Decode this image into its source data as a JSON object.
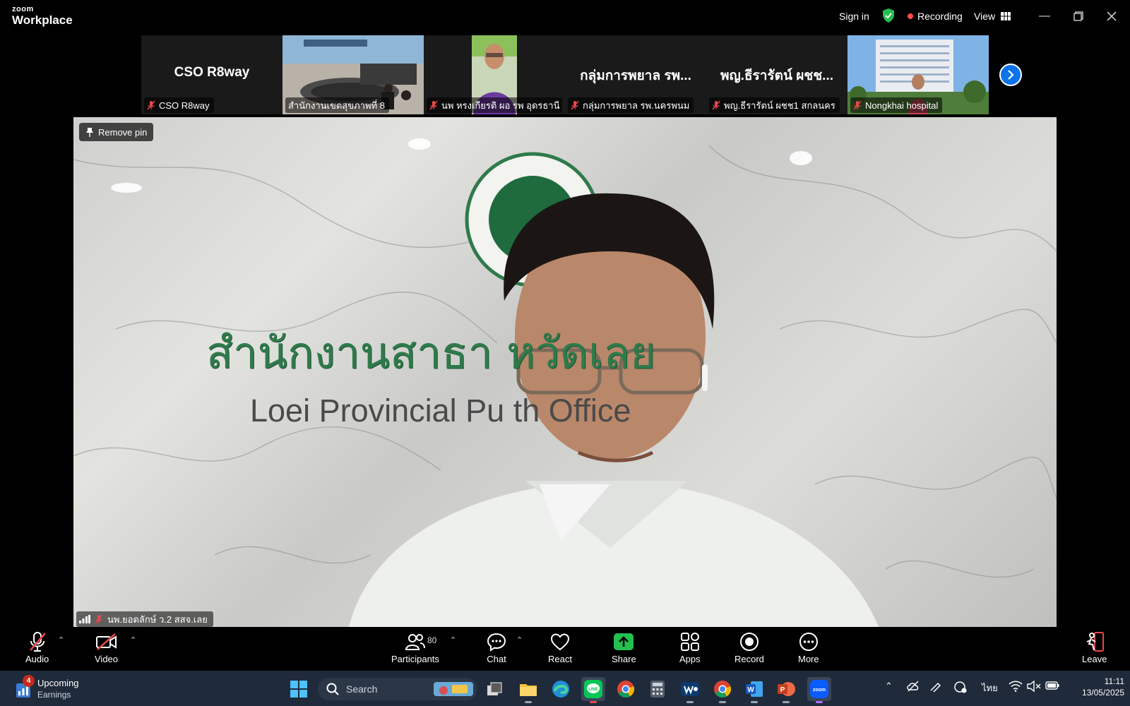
{
  "brand": {
    "line1": "zoom",
    "line2": "Workplace"
  },
  "titlebar": {
    "sign_in": "Sign in",
    "recording": "Recording",
    "view": "View"
  },
  "thumbnails": [
    {
      "title": "CSO R8way",
      "label": "CSO R8way",
      "type": "name"
    },
    {
      "title": "",
      "label": "สำนักงานเขตสุขภาพที่ 8",
      "type": "video-room"
    },
    {
      "title": "",
      "label": "นพ หรงเกียรติ ผอ รพ อุดรธานี",
      "type": "video-person"
    },
    {
      "title": "กลุ่มการพยาล รพ...",
      "label": "กลุ่มการพยาล รพ.นครพนม",
      "type": "name"
    },
    {
      "title": "พญ.ธีรารัตน์ ผชช...",
      "label": "พญ.ธีรารัตน์ ผชช1 สกลนคร",
      "type": "name"
    },
    {
      "title": "",
      "label": "Nongkhai hospital",
      "type": "video-building"
    }
  ],
  "main_video": {
    "remove_pin": "Remove pin",
    "sign_thai": "สำนักงานสาธา        หวัดเลย",
    "sign_english": "Loei Provincial Pu          th Office",
    "speaker_label": "นพ.ยอดลักษ์ ว.2 สสจ.เลย"
  },
  "toolbar": {
    "audio": "Audio",
    "video": "Video",
    "participants": "Participants",
    "participants_count": "80",
    "chat": "Chat",
    "react": "React",
    "share": "Share",
    "apps": "Apps",
    "record": "Record",
    "more": "More",
    "leave": "Leave"
  },
  "taskbar": {
    "widget_badge": "4",
    "widget_title": "Upcoming",
    "widget_subtitle": "Earnings",
    "search_placeholder": "Search",
    "language": "ไทย",
    "time": "11:11",
    "date": "13/05/2025"
  },
  "colors": {
    "zoom_blue": "#0e72ed",
    "share_green": "#24c04f",
    "recording_red": "#ff4d4d",
    "mute_red": "#e8474b"
  }
}
